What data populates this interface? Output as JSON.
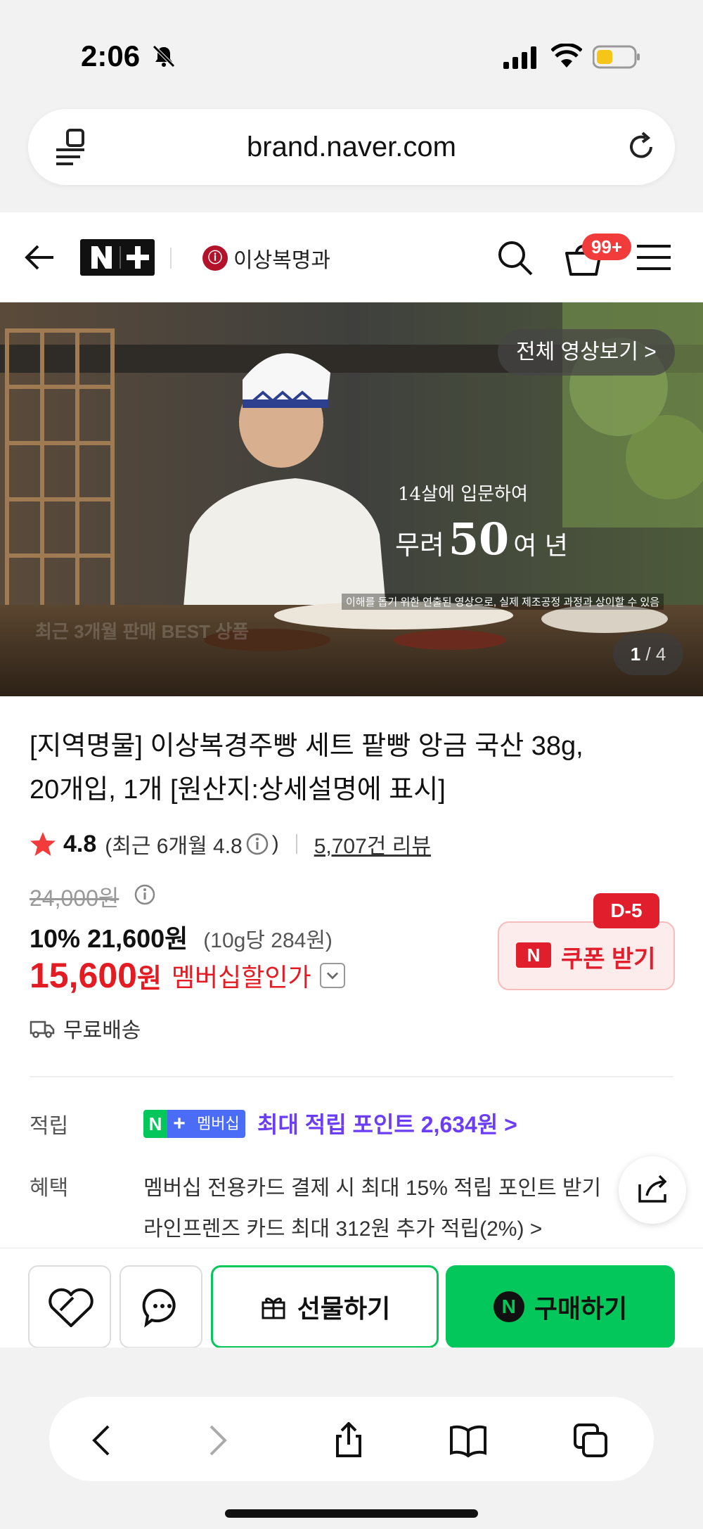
{
  "status_bar": {
    "time": "2:06"
  },
  "browser": {
    "url": "brand.naver.com"
  },
  "header": {
    "brand_name": "이상복명과",
    "brand_mark": "ⓘ",
    "nplus_label": "N+",
    "cart_badge": "99+"
  },
  "hero": {
    "video_button": "전체 영상보기 >",
    "caption_small": "14살에 입문하여",
    "caption_pre": "무려",
    "caption_big": "50",
    "caption_post": "여 년",
    "caption_note": "이해를 돕기 위한 연출된 영상으로, 실제 제조공정 과정과 상이할 수 있음",
    "watermark": "최근 3개월 판매 BEST 상품",
    "counter_current": "1",
    "counter_total": "/ 4"
  },
  "product": {
    "title_line1": "[지역명물] 이상복경주빵 세트 팥빵 앙금 국산 38g,",
    "title_line2": "20개입, 1개 [원산지:상세설명에 표시]",
    "rating": "4.8",
    "rating_recent": "(최근 6개월 4.8",
    "rating_close": ")",
    "review_count": "5,707건 리뷰",
    "original_price": "24,000원",
    "discount_rate": "10%",
    "discount_price": "21,600원",
    "unit_price": "(10g당 284원)",
    "member_price": "15,600",
    "member_won": "원",
    "member_label": "멤버십할인가",
    "shipping": "무료배송"
  },
  "coupon": {
    "dday": "D-5",
    "n_label": "N",
    "label": "쿠폰 받기"
  },
  "points": {
    "label": "적립",
    "badge_n": "N",
    "badge_plus": "+",
    "badge_member": "멤버십",
    "text": "최대 적립 포인트 2,634원 >"
  },
  "benefit": {
    "label": "혜택",
    "line1": "멤버십 전용카드 결제 시 최대 15% 적립 포인트 받기",
    "line2": "라인프렌즈 카드 최대 312원 추가 적립(2%) >"
  },
  "actions": {
    "gift": "선물하기",
    "buy": "구매하기",
    "buy_n": "N"
  },
  "colors": {
    "naver_green": "#03c75a",
    "sale_red": "#e31b23",
    "point_purple": "#6b3df5"
  }
}
